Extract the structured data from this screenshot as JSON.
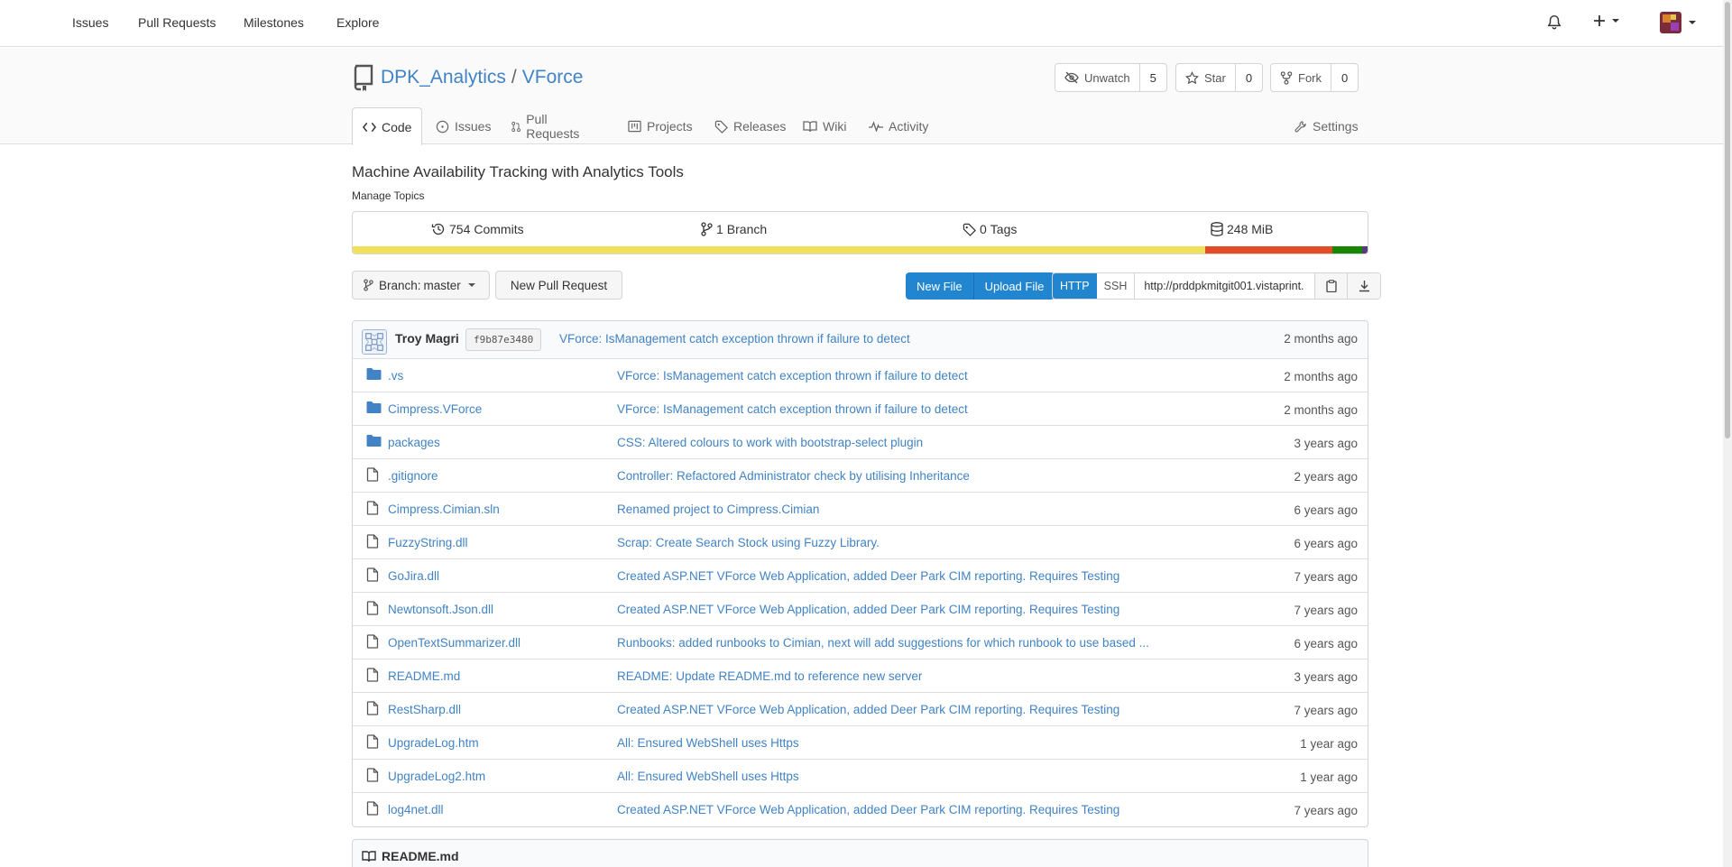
{
  "nav": {
    "items": [
      "Issues",
      "Pull Requests",
      "Milestones",
      "Explore"
    ]
  },
  "repo": {
    "owner": "DPK_Analytics",
    "name": "VForce",
    "watch_label": "Unwatch",
    "watch_count": "5",
    "star_label": "Star",
    "star_count": "0",
    "fork_label": "Fork",
    "fork_count": "0",
    "description": "Machine Availability Tracking with Analytics Tools",
    "topics_label": "Manage Topics"
  },
  "tabs": {
    "code": "Code",
    "issues": "Issues",
    "pulls": "Pull Requests",
    "projects": "Projects",
    "releases": "Releases",
    "wiki": "Wiki",
    "activity": "Activity",
    "settings": "Settings"
  },
  "stats": {
    "commits_count": "754",
    "commits_label": "Commits",
    "branch_count": "1",
    "branch_label": "Branch",
    "tags_count": "0",
    "tags_label": "Tags",
    "size": "248 MiB"
  },
  "languages": [
    {
      "color": "#f1e05a",
      "fraction": 0.84
    },
    {
      "color": "#e34c26",
      "fraction": 0.125
    },
    {
      "color": "#178600",
      "fraction": 0.03
    },
    {
      "color": "#563d7c",
      "fraction": 0.005
    }
  ],
  "toolbar": {
    "branch_prefix": "Branch:",
    "branch_name": "master",
    "new_pr": "New Pull Request",
    "new_file": "New File",
    "upload_file": "Upload File",
    "http": "HTTP",
    "ssh": "SSH",
    "clone_url": "http://prddpkmitgit001.vistaprint."
  },
  "latest_commit": {
    "author": "Troy Magri",
    "sha": "f9b87e3480",
    "message": "VForce: IsManagement catch exception thrown if failure to detect",
    "age": "2 months ago"
  },
  "files": [
    {
      "type": "folder",
      "name": ".vs",
      "message": "VForce: IsManagement catch exception thrown if failure to detect",
      "age": "2 months ago"
    },
    {
      "type": "folder",
      "name": "Cimpress.VForce",
      "message": "VForce: IsManagement catch exception thrown if failure to detect",
      "age": "2 months ago"
    },
    {
      "type": "folder",
      "name": "packages",
      "message": "CSS: Altered colours to work with bootstrap-select plugin",
      "age": "3 years ago"
    },
    {
      "type": "file",
      "name": ".gitignore",
      "message": "Controller: Refactored Administrator check by utilising Inheritance",
      "age": "2 years ago"
    },
    {
      "type": "file",
      "name": "Cimpress.Cimian.sln",
      "message": "Renamed project to Cimpress.Cimian",
      "age": "6 years ago"
    },
    {
      "type": "file",
      "name": "FuzzyString.dll",
      "message": "Scrap: Create Search Stock using Fuzzy Library.",
      "age": "6 years ago"
    },
    {
      "type": "file",
      "name": "GoJira.dll",
      "message": "Created ASP.NET VForce Web Application, added Deer Park CIM reporting. Requires Testing",
      "age": "7 years ago"
    },
    {
      "type": "file",
      "name": "Newtonsoft.Json.dll",
      "message": "Created ASP.NET VForce Web Application, added Deer Park CIM reporting. Requires Testing",
      "age": "7 years ago"
    },
    {
      "type": "file",
      "name": "OpenTextSummarizer.dll",
      "message": "Runbooks: added runbooks to Cimian, next will add suggestions for which runbook to use based ...",
      "age": "6 years ago"
    },
    {
      "type": "file",
      "name": "README.md",
      "message": "README: Update README.md to reference new server",
      "age": "3 years ago"
    },
    {
      "type": "file",
      "name": "RestSharp.dll",
      "message": "Created ASP.NET VForce Web Application, added Deer Park CIM reporting. Requires Testing",
      "age": "7 years ago"
    },
    {
      "type": "file",
      "name": "UpgradeLog.htm",
      "message": "All: Ensured WebShell uses Https",
      "age": "1 year ago"
    },
    {
      "type": "file",
      "name": "UpgradeLog2.htm",
      "message": "All: Ensured WebShell uses Https",
      "age": "1 year ago"
    },
    {
      "type": "file",
      "name": "log4net.dll",
      "message": "Created ASP.NET VForce Web Application, added Deer Park CIM reporting. Requires Testing",
      "age": "7 years ago"
    }
  ],
  "readme": {
    "title": "README.md"
  },
  "colors": {
    "link": "#4183c4",
    "primary": "#2185d0",
    "folder": "#4183c4"
  }
}
